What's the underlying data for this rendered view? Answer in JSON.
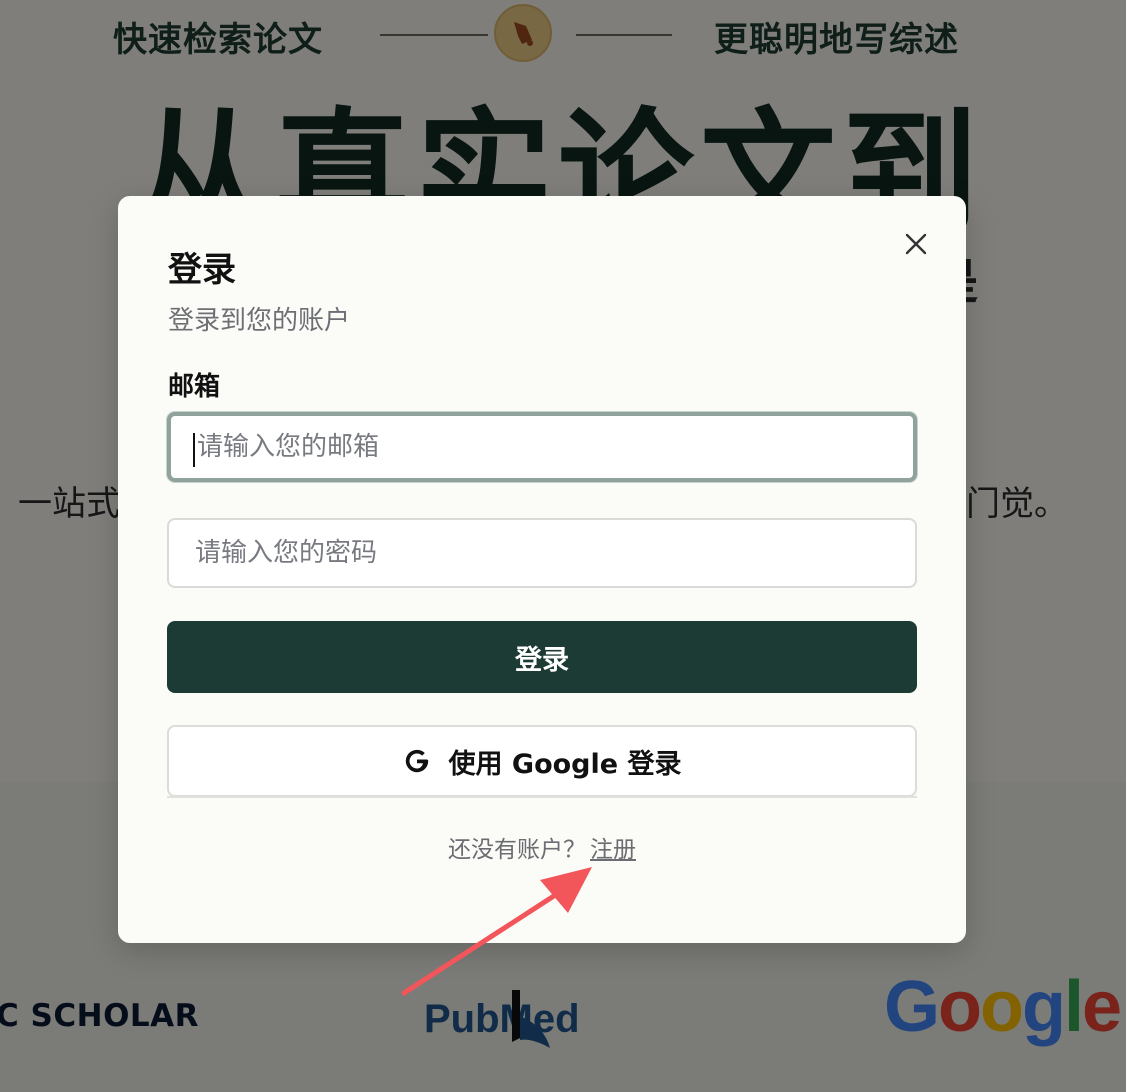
{
  "background": {
    "hero_left_tag": "快速检索论文",
    "hero_right_tag": "更聪明地写综述",
    "hero_headline": "从真实论文到",
    "hero_headline_fragment": "是",
    "hero_sub_left": "一站式",
    "hero_sub_right": "门觉。",
    "brands": {
      "scholar": "C SCHOLAR",
      "pubmed": "PubMed",
      "google": "Google"
    }
  },
  "modal": {
    "title": "登录",
    "subtitle": "登录到您的账户",
    "email_label": "邮箱",
    "email_placeholder": "请输入您的邮箱",
    "email_value": "",
    "password_placeholder": "请输入您的密码",
    "password_value": "",
    "login_button": "登录",
    "google_button": "使用 Google 登录",
    "signup_prompt": "还没有账户？",
    "signup_link": "注册"
  },
  "icons": {
    "close": "close-icon",
    "google": "google-g-icon",
    "logo": "bell-logo-icon",
    "annotation_arrow": "red-arrow"
  },
  "colors": {
    "primary_dark_green": "#1d3b35",
    "annotation_red": "#f2555a",
    "google_blue": "#4285F4",
    "google_red": "#EA4335",
    "google_yellow": "#FBBC05",
    "google_green": "#34A853",
    "pubmed_blue": "#20558a"
  }
}
